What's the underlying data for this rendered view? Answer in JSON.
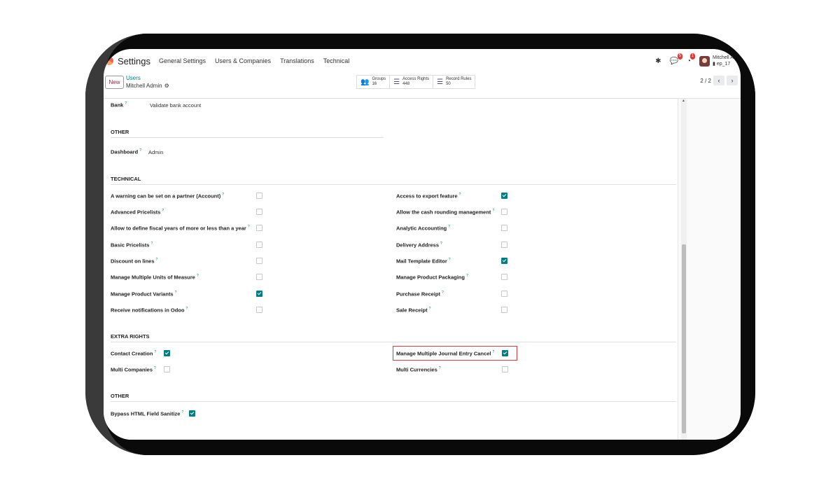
{
  "navbar": {
    "app_title": "Settings",
    "menu": [
      "General Settings",
      "Users & Companies",
      "Translations",
      "Technical"
    ],
    "chat_badge": "5",
    "activity_badge": "1",
    "user_name": "Mitchell Ad",
    "user_db": "ep_17"
  },
  "control": {
    "new_label": "New",
    "breadcrumb_parent": "Users",
    "breadcrumb_current": "Mitchell Admin",
    "stats": [
      {
        "label": "Groups",
        "count": "16"
      },
      {
        "label": "Access Rights",
        "count": "448"
      },
      {
        "label": "Record Rules",
        "count": "50"
      }
    ],
    "pager": "2 / 2"
  },
  "form": {
    "bank_label": "Bank",
    "bank_value": "Validate bank account",
    "other_title": "OTHER",
    "dashboard_label": "Dashboard",
    "dashboard_value": "Admin",
    "technical_title": "TECHNICAL",
    "technical_left": [
      {
        "label": "A warning can be set on a partner (Account)",
        "checked": false
      },
      {
        "label": "Advanced Pricelists",
        "checked": false
      },
      {
        "label": "Allow to define fiscal years of more or less than a year",
        "checked": false
      },
      {
        "label": "Basic Pricelists",
        "checked": false
      },
      {
        "label": "Discount on lines",
        "checked": false
      },
      {
        "label": "Manage Multiple Units of Measure",
        "checked": false
      },
      {
        "label": "Manage Product Variants",
        "checked": true
      },
      {
        "label": "Receive notifications in Odoo",
        "checked": false
      }
    ],
    "technical_right": [
      {
        "label": "Access to export feature",
        "checked": true
      },
      {
        "label": "Allow the cash rounding management",
        "checked": false
      },
      {
        "label": "Analytic Accounting",
        "checked": false
      },
      {
        "label": "Delivery Address",
        "checked": false
      },
      {
        "label": "Mail Template Editor",
        "checked": true
      },
      {
        "label": "Manage Product Packaging",
        "checked": false
      },
      {
        "label": "Purchase Receipt",
        "checked": false
      },
      {
        "label": "Sale Receipt",
        "checked": false
      }
    ],
    "extra_title": "EXTRA RIGHTS",
    "extra_left": [
      {
        "label": "Contact Creation",
        "checked": true
      },
      {
        "label": "Multi Companies",
        "checked": false
      }
    ],
    "extra_right": [
      {
        "label": "Manage Multiple Journal Entry Cancel",
        "checked": true
      },
      {
        "label": "Multi Currencies",
        "checked": false
      }
    ],
    "other2_title": "OTHER",
    "bypass_label": "Bypass HTML Field Sanitize",
    "bypass_checked": true,
    "help_mark": "?"
  },
  "colors": {
    "accent": "#017e84",
    "brand": "#7b2d43",
    "highlight": "#e53935"
  }
}
